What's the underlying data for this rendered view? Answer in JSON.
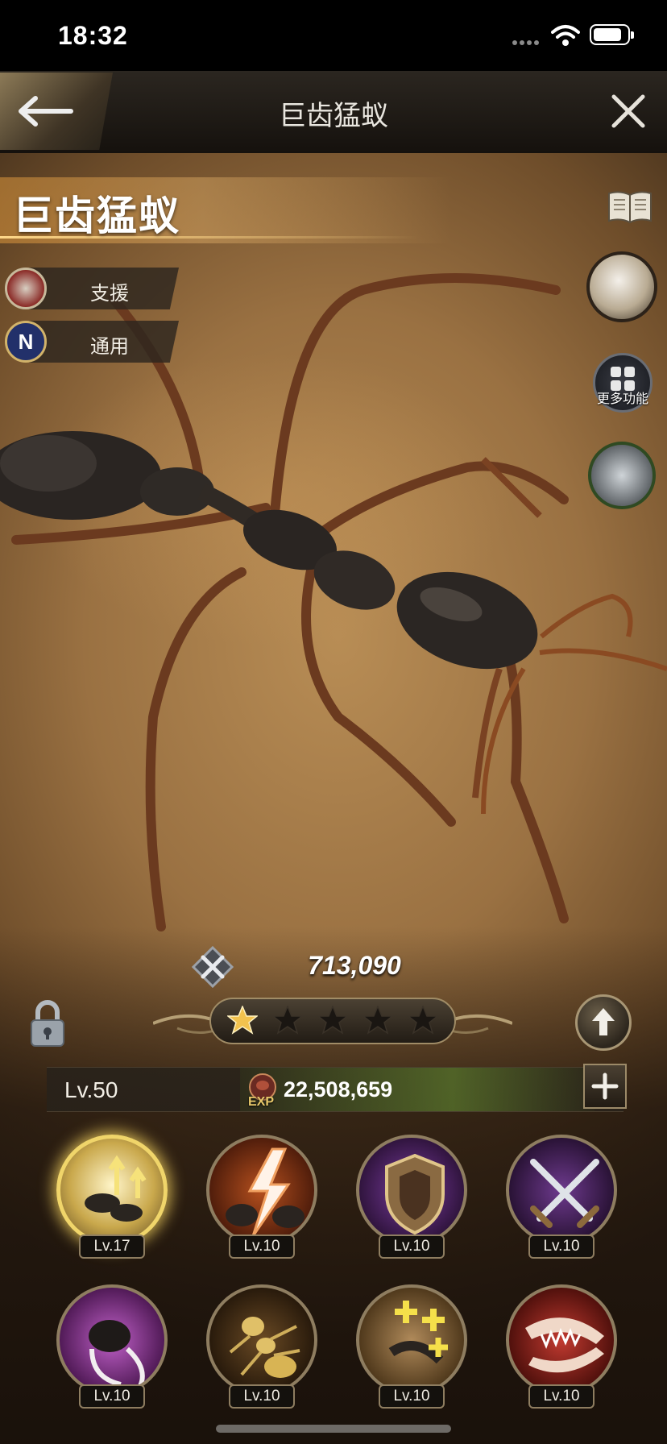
{
  "status_bar": {
    "time": "18:32"
  },
  "header": {
    "title": "巨齿猛蚁"
  },
  "ant": {
    "name": "巨齿猛蚁",
    "tags": [
      {
        "icon": "support-icon",
        "label": "支援"
      },
      {
        "icon": "n-badge-icon",
        "label": "通用"
      }
    ],
    "power": "713,090",
    "stars_filled": 1,
    "stars_total": 5,
    "level": "Lv.50",
    "exp_label": "EXP",
    "exp_value": "22,508,659"
  },
  "side_menu": {
    "more_label": "更多功能"
  },
  "skills": [
    {
      "icon": "ant-upgrade-icon",
      "level": "Lv.17",
      "active": true
    },
    {
      "icon": "lightning-attack-icon",
      "level": "Lv.10"
    },
    {
      "icon": "defense-shield-icon",
      "level": "Lv.10"
    },
    {
      "icon": "crossed-swords-icon",
      "level": "Lv.10"
    },
    {
      "icon": "mandible-slash-icon",
      "level": "Lv.10"
    },
    {
      "icon": "golden-ant-icon",
      "level": "Lv.10"
    },
    {
      "icon": "heal-plus-icon",
      "level": "Lv.10"
    },
    {
      "icon": "jaw-bite-icon",
      "level": "Lv.10"
    }
  ],
  "colors": {
    "gold": "#f0d56a",
    "frame": "#8e7d60",
    "exp_green": "#6e9632"
  }
}
